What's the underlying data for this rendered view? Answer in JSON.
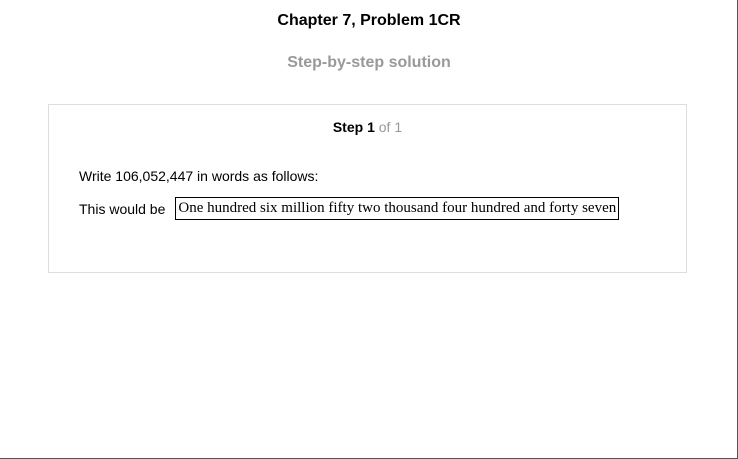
{
  "header": {
    "title": "Chapter 7, Problem 1CR",
    "subtitle": "Step-by-step solution"
  },
  "step": {
    "label": "Step",
    "number": "1",
    "of_label": "of",
    "total": "1"
  },
  "content": {
    "instruction": "Write 106,052,447 in words as follows:",
    "answer_prefix": "This would be",
    "answer": "One hundred six million fifty two thousand four hundred and forty seven"
  },
  "colors": {
    "title": "#000000",
    "subtitle": "#999999",
    "card_border": "#dddddd"
  }
}
